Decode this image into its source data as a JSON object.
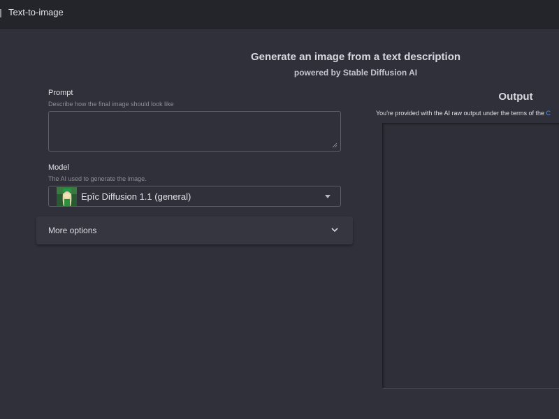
{
  "app": {
    "title": "Text-to-image"
  },
  "hero": {
    "title": "Generate an image from a text description",
    "subtitle": "powered by Stable Diffusion AI"
  },
  "prompt": {
    "label": "Prompt",
    "hint": "Describe how the final image should look like",
    "value": ""
  },
  "model": {
    "label": "Model",
    "hint": "The AI used to generate the image.",
    "selected": "Epîc Diffusion 1.1 (general)",
    "icons": {
      "thumbnail": "model-thumbnail-image",
      "caret": "caret-down-icon"
    }
  },
  "more_options": {
    "label": "More options",
    "icon": "chevron-down-icon"
  },
  "output": {
    "title": "Output",
    "terms_text": "You're provided with the AI raw output under the terms of the ",
    "terms_link": "C"
  },
  "colors": {
    "background": "#30303a",
    "topbar": "#24242b",
    "link": "#5a8fd8"
  }
}
